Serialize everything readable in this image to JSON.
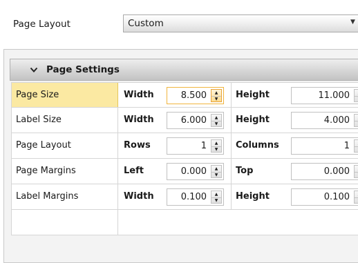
{
  "header": {
    "page_layout_label": "Page Layout",
    "dropdown_value": "Custom"
  },
  "panel": {
    "title": "Page Settings"
  },
  "rows": [
    {
      "label": "Page Size",
      "field1": "Width",
      "value1": "8.500",
      "field2": "Height",
      "value2": "11.000"
    },
    {
      "label": "Label Size",
      "field1": "Width",
      "value1": "6.000",
      "field2": "Height",
      "value2": "4.000"
    },
    {
      "label": "Page Layout",
      "field1": "Rows",
      "value1": "1",
      "field2": "Columns",
      "value2": "1"
    },
    {
      "label": "Page Margins",
      "field1": "Left",
      "value1": "0.000",
      "field2": "Top",
      "value2": "0.000"
    },
    {
      "label": "Label Margins",
      "field1": "Width",
      "value1": "0.100",
      "field2": "Height",
      "value2": "0.100"
    }
  ],
  "selected_row": "Page Size",
  "colors": {
    "selected_row_bg": "#fbe9a2",
    "focus_accent": "#f0b43c",
    "panel_bg": "#f3f3f3"
  },
  "icons": {
    "dropdown": "chevron-down-icon",
    "panel_toggle": "chevron-down-icon",
    "spin_up": "spin-up-icon",
    "spin_down": "spin-down-icon"
  }
}
